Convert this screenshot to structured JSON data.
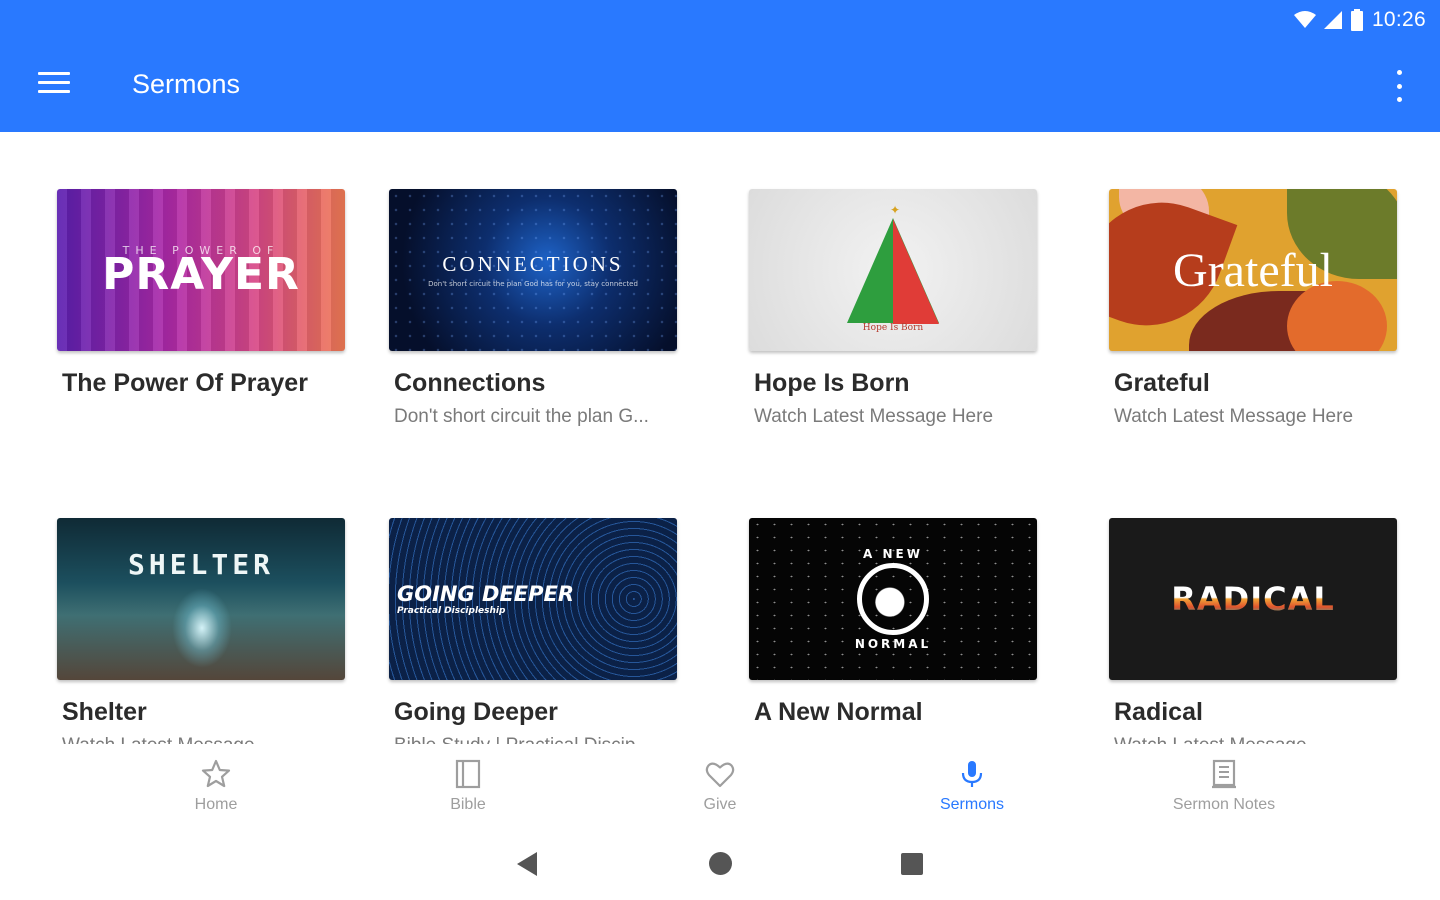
{
  "status_bar": {
    "time": "10:26"
  },
  "toolbar": {
    "title": "Sermons"
  },
  "sermons": [
    {
      "title": "The Power Of Prayer",
      "subtitle": "",
      "art_line1": "THE POWER OF",
      "art_line2": "PRAYER"
    },
    {
      "title": "Connections",
      "subtitle": "Don't short circuit the plan G...",
      "art_line1": "CONNECTIONS",
      "art_line2": "Don't short circuit the plan God has for you, stay connected"
    },
    {
      "title": "Hope Is Born",
      "subtitle": "Watch Latest Message Here",
      "art_line1": "Hope Is Born",
      "art_line2": ""
    },
    {
      "title": "Grateful",
      "subtitle": "Watch Latest Message Here",
      "art_line1": "Grateful",
      "art_line2": ""
    },
    {
      "title": "Shelter",
      "subtitle": "Watch Latest Message",
      "art_line1": "SHELTER",
      "art_line2": ""
    },
    {
      "title": "Going Deeper",
      "subtitle": "Bible Study | Practical Discip...",
      "art_line1": "GOING DEEPER",
      "art_line2": "Practical Discipleship"
    },
    {
      "title": "A New Normal",
      "subtitle": "",
      "art_line1": "A NEW",
      "art_line2": "NORMAL"
    },
    {
      "title": "Radical",
      "subtitle": "Watch Latest Message",
      "art_line1": "RADICAL",
      "art_line2": ""
    }
  ],
  "bottom_nav": [
    {
      "label": "Home",
      "icon": "star-icon",
      "active": false
    },
    {
      "label": "Bible",
      "icon": "book-icon",
      "active": false
    },
    {
      "label": "Give",
      "icon": "heart-icon",
      "active": false
    },
    {
      "label": "Sermons",
      "icon": "microphone-icon",
      "active": true
    },
    {
      "label": "Sermon Notes",
      "icon": "notes-icon",
      "active": false
    }
  ],
  "colors": {
    "primary": "#2979ff",
    "nav_inactive": "#9e9e9e"
  }
}
